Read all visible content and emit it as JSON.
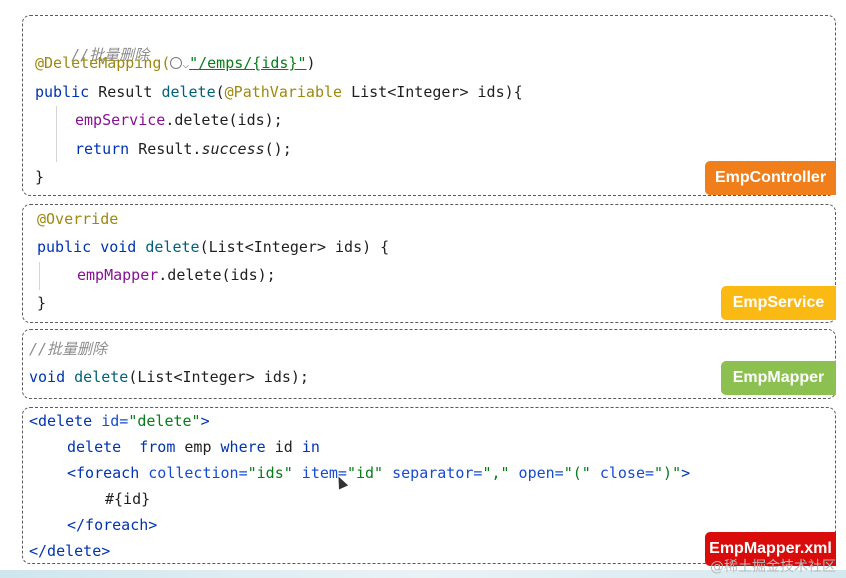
{
  "controller": {
    "comment": "//批量删除",
    "mapping_anno": "@DeleteMapping(",
    "mapping_path": "\"/emps/{ids}\"",
    "mapping_close": ")",
    "sig_public": "public",
    "sig_type": " Result ",
    "sig_name": "delete",
    "sig_open": "(",
    "sig_anno": "@PathVariable",
    "sig_rest": " List<Integer> ids){",
    "l1_field": "empService",
    "l1_rest": ".delete(ids);",
    "l2_return": "return",
    "l2_mid": " Result.",
    "l2_success": "success",
    "l2_end": "();",
    "close": "}",
    "badge": "EmpController"
  },
  "service": {
    "override": "@Override",
    "sig_public": "public",
    "sig_void": " void ",
    "sig_name": "delete",
    "sig_rest": "(List<Integer> ids) {",
    "l1_field": "empMapper",
    "l1_rest": ".delete(ids);",
    "close": "}",
    "badge": "EmpService"
  },
  "mapper": {
    "comment": "//批量删除",
    "sig_void": "void",
    "sig_name": " delete",
    "sig_rest": "(List<Integer> ids);",
    "badge": "EmpMapper"
  },
  "xml": {
    "l1_tag": "<delete",
    "l1_attr": " id=",
    "l1_val": "\"delete\"",
    "l1_end": ">",
    "l2_delete": "delete",
    "l2_from": "from",
    "l2_emp": " emp ",
    "l2_where": "where",
    "l2_id": " id ",
    "l2_in": "in",
    "l3_tag": "<foreach",
    "l3_a1": " collection=",
    "l3_v1": "\"ids\"",
    "l3_a2": " item=",
    "l3_v2": "\"id\"",
    "l3_a3": " separator=",
    "l3_v3": "\",\"",
    "l3_a4": " open=",
    "l3_v4": "\"(\"",
    "l3_a5": " close=",
    "l3_v5": "\")\"",
    "l3_end": ">",
    "l4": "#{id}",
    "l5": "</foreach>",
    "l6": "</delete>",
    "badge": "EmpMapper.xml"
  },
  "colors": {
    "badge_controller": "#f07f1b",
    "badge_service": "#fbb914",
    "badge_mapper": "#8cc152",
    "badge_xml": "#d90b0b"
  },
  "watermark": "@稀土掘金技术社区"
}
